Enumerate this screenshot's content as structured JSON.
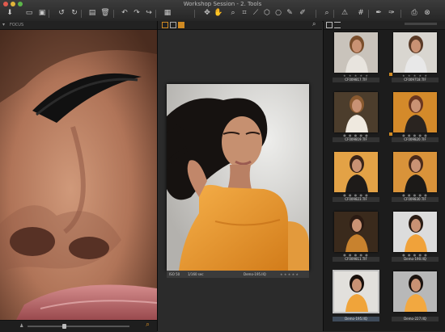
{
  "window": {
    "title": "Workshop Session - 2. Tools"
  },
  "toolbar": {
    "buttons": [
      {
        "name": "import-icon",
        "glyph": "⬇"
      },
      {
        "name": "capture-icon",
        "glyph": "▭"
      },
      {
        "name": "video-icon",
        "glyph": "▣"
      },
      {
        "name": "reset-icon",
        "glyph": "↺"
      },
      {
        "name": "rotate-icon",
        "glyph": "↻"
      },
      {
        "name": "folder-icon",
        "glyph": "▤"
      },
      {
        "name": "trash-icon",
        "glyph": "🗑"
      },
      {
        "name": "undo-icon",
        "glyph": "↶"
      },
      {
        "name": "redo-icon",
        "glyph": "↷"
      },
      {
        "name": "forward-icon",
        "glyph": "↪"
      },
      {
        "name": "film-icon",
        "glyph": "▦"
      },
      {
        "name": "pan-icon",
        "glyph": "✥"
      },
      {
        "name": "hand-icon",
        "glyph": "✋"
      },
      {
        "name": "zoom-tool-icon",
        "glyph": "⌕"
      },
      {
        "name": "crop-icon",
        "glyph": "⌗"
      },
      {
        "name": "straighten-icon",
        "glyph": "⟋"
      },
      {
        "name": "keystone-icon",
        "glyph": "⬡"
      },
      {
        "name": "spot-icon",
        "glyph": "○"
      },
      {
        "name": "brush-icon",
        "glyph": "✎"
      },
      {
        "name": "picker-icon",
        "glyph": "✐"
      },
      {
        "name": "loupe-icon",
        "glyph": "⌕"
      },
      {
        "name": "warning-icon",
        "glyph": "⚠"
      },
      {
        "name": "grid-icon",
        "glyph": "#"
      },
      {
        "name": "eyedropper-icon",
        "glyph": "✒"
      },
      {
        "name": "pen-icon",
        "glyph": "✑"
      },
      {
        "name": "print-icon",
        "glyph": "⎙"
      },
      {
        "name": "settings-icon",
        "glyph": "⊗"
      }
    ]
  },
  "left_viewer": {
    "header_label": "FOCUS",
    "close_glyph": "▾"
  },
  "center_viewer": {
    "photo_info": {
      "iso": "ISO 50",
      "shutter": "1/160 sec",
      "filename": "Demo-195.IIQ",
      "stars": "★ ★ ★ ★ ★"
    }
  },
  "browser": {
    "thumbnails": [
      {
        "label": "CF009817.TIF",
        "stars": "★ ★ ★ ★ ★",
        "bg": "#c9c3bb",
        "shirt": "#e8e4de",
        "hair": "#7a4e2c",
        "tag": false,
        "selected": false
      },
      {
        "label": "CF009718.TIF",
        "stars": "★ ★ ★ ★ ★",
        "bg": "#d9d6d0",
        "shirt": "#e8e8e8",
        "hair": "#5a3a26",
        "tag": true,
        "selected": false
      },
      {
        "label": "CF009819.TIF",
        "stars": "● ● ● ● ●",
        "bg": "#4c3d2c",
        "shirt": "#efe9df",
        "hair": "#8a5a30",
        "tag": false,
        "selected": false
      },
      {
        "label": "CF009820.TIF",
        "stars": "● ● ● ● ●",
        "bg": "#d48a2a",
        "shirt": "#2a2420",
        "hair": "#6a3620",
        "tag": true,
        "selected": false
      },
      {
        "label": "CF009823.TIF",
        "stars": "● ● ● ● ●",
        "bg": "#e3a246",
        "shirt": "#1e1b19",
        "hair": "#3a2418",
        "tag": false,
        "selected": false
      },
      {
        "label": "CF009830.TIF",
        "stars": "● ● ● ● ●",
        "bg": "#d9933a",
        "shirt": "#1c1a18",
        "hair": "#4a2a1a",
        "tag": false,
        "selected": false
      },
      {
        "label": "CF009811.TIF",
        "stars": "● ● ● ● ●",
        "bg": "#3a2a1c",
        "shirt": "#c8822e",
        "hair": "#2a1a12",
        "tag": false,
        "selected": false
      },
      {
        "label": "Demo-190.IIQ",
        "stars": "● ● ● ● ●",
        "bg": "#dcdcdc",
        "shirt": "#f0a23a",
        "hair": "#2a1c14",
        "tag": false,
        "selected": false
      },
      {
        "label": "Demo-195.IIQ",
        "stars": "",
        "bg": "#e2e0dc",
        "shirt": "#f0a43a",
        "hair": "#18100c",
        "tag": false,
        "selected": true
      },
      {
        "label": "Demo-227.IIQ",
        "stars": "",
        "bg": "#b8b8b8",
        "shirt": "#f2a840",
        "hair": "#1a120e",
        "tag": false,
        "selected": false
      }
    ]
  },
  "colors": {
    "accent_orange": "#d08a22",
    "selection_blue": "#3f4b5a"
  }
}
